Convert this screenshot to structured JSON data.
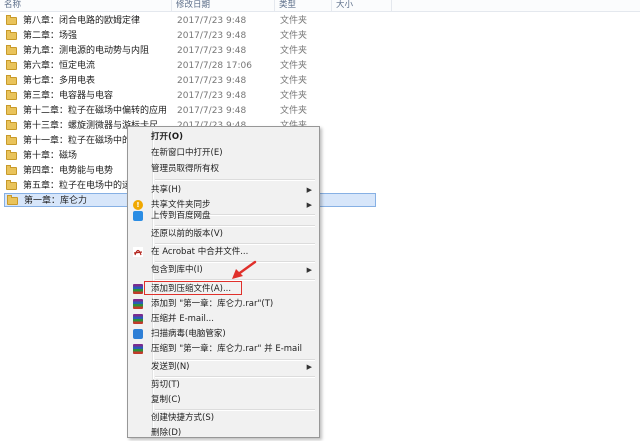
{
  "header": {
    "col_name": "名称",
    "col_date": "修改日期",
    "col_type": "类型",
    "col_size": "大小"
  },
  "files": [
    {
      "name": "第八章：闭合电路的欧姆定律",
      "date": "2017/7/23 9:48",
      "type": "文件夹"
    },
    {
      "name": "第二章：场强",
      "date": "2017/7/23 9:48",
      "type": "文件夹"
    },
    {
      "name": "第九章：测电源的电动势与内阻",
      "date": "2017/7/23 9:48",
      "type": "文件夹"
    },
    {
      "name": "第六章：恒定电流",
      "date": "2017/7/28 17:06",
      "type": "文件夹"
    },
    {
      "name": "第七章：多用电表",
      "date": "2017/7/23 9:48",
      "type": "文件夹"
    },
    {
      "name": "第三章：电容器与电容",
      "date": "2017/7/23 9:48",
      "type": "文件夹"
    },
    {
      "name": "第十二章：粒子在磁场中偏转的应用",
      "date": "2017/7/23 9:48",
      "type": "文件夹"
    },
    {
      "name": "第十三章：螺旋测微器与游标卡尺",
      "date": "2017/7/23 9:48",
      "type": "文件夹"
    },
    {
      "name": "第十一章：粒子在磁场中的偏转",
      "date": "",
      "type": ""
    },
    {
      "name": "第十章：磁场",
      "date": "",
      "type": ""
    },
    {
      "name": "第四章：电势能与电势",
      "date": "",
      "type": ""
    },
    {
      "name": "第五章：粒子在电场中的运动",
      "date": "",
      "type": ""
    },
    {
      "name": "第一章：库仑力",
      "date": "",
      "type": ""
    }
  ],
  "menu": {
    "open": "打开(O)",
    "open_new_window": "在新窗口中打开(E)",
    "admin_ownership": "管理员取得所有权",
    "share": "共享(H)",
    "share_sync": "共享文件夹同步",
    "upload_baidu": "上传到百度网盘",
    "restore_versions": "还原以前的版本(V)",
    "acrobat_merge": "在 Acrobat 中合并文件...",
    "include_library": "包含到库中(I)",
    "add_archive": "添加到压缩文件(A)...",
    "add_rar": "添加到 \"第一章：库仑力.rar\"(T)",
    "compress_email": "压缩并 E-mail...",
    "scan_virus": "扫描病毒(电脑管家)",
    "compress_rar_email": "压缩到 \"第一章：库仑力.rar\" 并 E-mail",
    "send_to": "发送到(N)",
    "cut": "剪切(T)",
    "copy": "复制(C)",
    "create_shortcut": "创建快捷方式(S)",
    "delete": "删除(D)",
    "arrow_glyph": "▶",
    "warn_glyph": "!"
  },
  "colors": {
    "accent_red": "#e0302b",
    "selection": "#d7e6fa",
    "folder": "#e9c35b"
  }
}
